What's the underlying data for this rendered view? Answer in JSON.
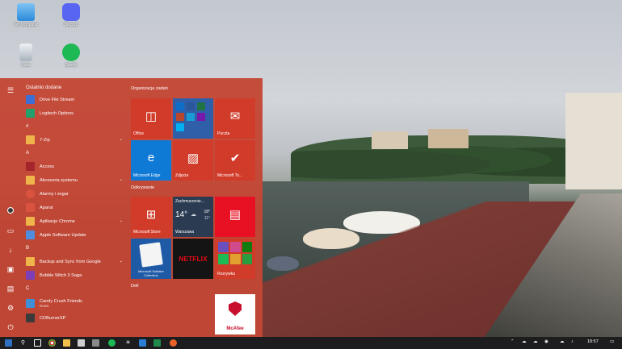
{
  "desktop": {
    "icons": [
      {
        "label": "Ten komputer"
      },
      {
        "label": "Discord"
      },
      {
        "label": "Kosz"
      },
      {
        "label": "Spotify"
      }
    ]
  },
  "start_menu": {
    "list": {
      "recent_header": "Ostatnio dodane",
      "recent": [
        {
          "name": "Drive File Stream"
        },
        {
          "name": "Logitech Options"
        }
      ],
      "letters": [
        "#",
        "A",
        "B",
        "C"
      ],
      "apps_hash": [
        {
          "name": "7-Zip"
        }
      ],
      "apps_a": [
        {
          "name": "Access"
        },
        {
          "name": "Akcesoria systemu"
        },
        {
          "name": "Alarmy i zegar"
        },
        {
          "name": "Aparat"
        },
        {
          "name": "Aplikacje Chrome"
        },
        {
          "name": "Apple Software Update"
        }
      ],
      "apps_b": [
        {
          "name": "Backup and Sync from Google"
        },
        {
          "name": "Bubble Witch 3 Saga"
        }
      ],
      "apps_c": [
        {
          "name": "Candy Crush Friends",
          "sub": "Nowe"
        },
        {
          "name": "CDBurnerXP"
        }
      ]
    },
    "tiles": {
      "group1": "Organizacja zadań",
      "group2": "Odkrywanie",
      "group3": "Dell",
      "office": "Office",
      "poczta": "Poczta",
      "edge": "Microsoft Edge",
      "zdjecia": "Zdjęcia",
      "todo": "Microsoft To...",
      "store": "Microsoft Store",
      "weather_title": "Zachmurzenie...",
      "weather_temp": "14°",
      "weather_hi": "18°",
      "weather_lo": "11°",
      "weather_city": "Warszawa",
      "solitaire": "Microsoft Solitaire Collection",
      "netflix": "NETFLIX",
      "rozrywka": "Rozrywka",
      "mcafee": "McAfee"
    }
  },
  "taskbar": {
    "time": "18:57"
  },
  "colors": {
    "accent": "#c44634",
    "tile_red": "#d13c2a",
    "edge_blue": "#0f7ad6",
    "netflix_red": "#e50914",
    "mcafee_red": "#c8102e"
  }
}
